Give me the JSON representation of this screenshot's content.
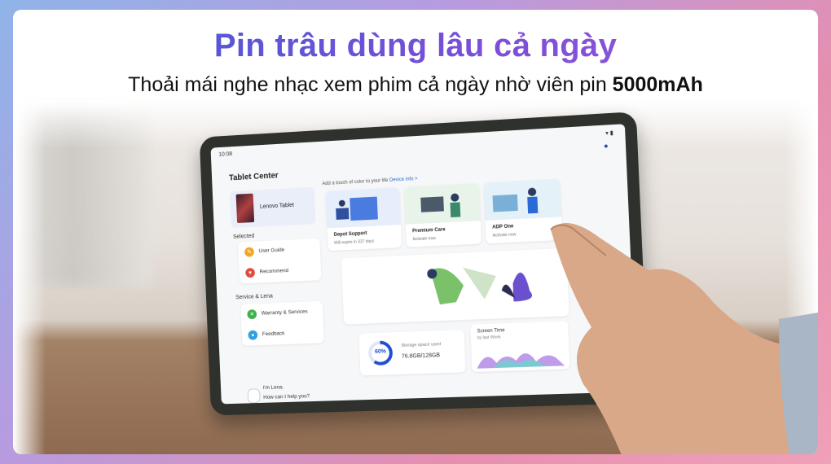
{
  "banner": {
    "title": "Pin trâu dùng lâu cả ngày",
    "subtitle_main": "Thoải mái nghe nhạc xem phim cả ngày nhờ viên pin ",
    "subtitle_bold": "5000mAh"
  },
  "tablet": {
    "status_time": "10:08",
    "app_title": "Tablet Center",
    "device_name": "Lenovo Tablet",
    "promo_text": "Add a touch of color to your life",
    "promo_link": "Device info >",
    "sections": {
      "selected": "Selected",
      "service": "Service & Lena"
    },
    "menu_selected": [
      {
        "label": "User Guide",
        "icon": "book-icon",
        "color": "#f2a623"
      },
      {
        "label": "Recommend",
        "icon": "heart-icon",
        "color": "#e24a3b"
      }
    ],
    "menu_service": [
      {
        "label": "Warranty & Services",
        "icon": "wrench-icon",
        "color": "#3cb04a"
      },
      {
        "label": "Feedback",
        "icon": "chat-icon",
        "color": "#2ea0e0"
      }
    ],
    "service_cards": [
      {
        "title": "Depot Support",
        "sub": "Will expire in 337 days"
      },
      {
        "title": "Premium Care",
        "sub": "Activate now"
      },
      {
        "title": "ADP One",
        "sub": "Activate now"
      }
    ],
    "storage": {
      "percent_label": "60%",
      "percent": 60,
      "label": "Storage space used",
      "value": "76.8GB/128GB"
    },
    "screen_time": {
      "title": "Screen Time",
      "sub": "by last Week"
    },
    "lena": {
      "line1": "I'm Lena.",
      "line2": "How can I help you?"
    }
  },
  "colors": {
    "accent": "#3f5bd6",
    "tablet_body": "#2e312c"
  }
}
